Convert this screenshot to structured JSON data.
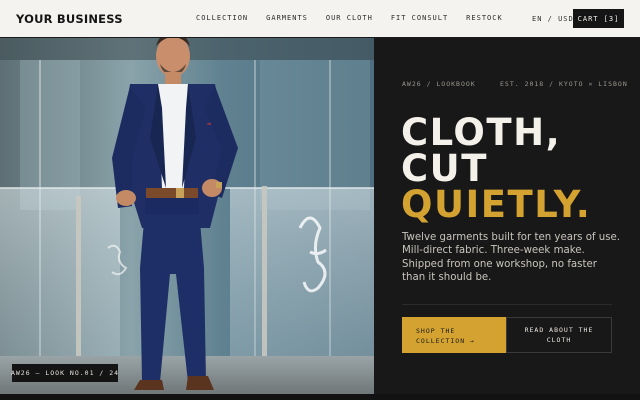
{
  "header": {
    "brand": "YOUR BUSINESS",
    "nav": [
      "COLLECTION",
      "GARMENTS",
      "OUR CLOTH",
      "FIT CONSULT",
      "RESTOCK"
    ],
    "language_currency": "EN / USD",
    "cart_label": "CART [3]"
  },
  "hero": {
    "image_tag": "AW26 — LOOK NO.01 / 24",
    "meta_left": "AW26 / LOOKBOOK",
    "meta_right": "EST. 2018 / KYOTO × LISBON",
    "headline": [
      "CLOTH,",
      "CUT",
      "QUIETLY."
    ],
    "lede": "Twelve garments built for ten years of use. Mill-direct fabric. Three-week make. Shipped from one workshop, no faster than it should be.",
    "primary_cta": [
      "SHOP THE",
      "COLLECTION →"
    ],
    "secondary_cta": [
      "READ ABOUT THE",
      "CLOTH"
    ]
  },
  "colors": {
    "accent": "#d3a231",
    "dark": "#181818",
    "light": "#f4f3f0"
  }
}
